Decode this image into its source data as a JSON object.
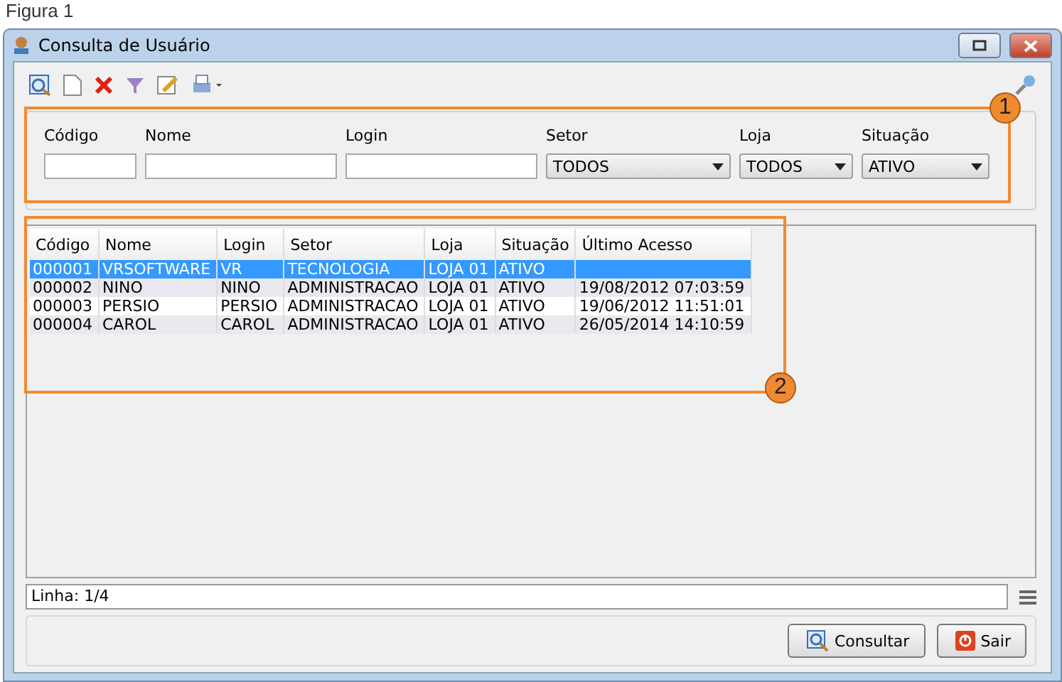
{
  "caption": "Figura 1",
  "window": {
    "title": "Consulta de Usuário"
  },
  "filters": [
    {
      "label": "Código",
      "kind": "text"
    },
    {
      "label": "Nome",
      "kind": "text"
    },
    {
      "label": "Login",
      "kind": "text"
    },
    {
      "label": "Setor",
      "kind": "select",
      "value": "TODOS"
    },
    {
      "label": "Loja",
      "kind": "select",
      "value": "TODOS"
    },
    {
      "label": "Situação",
      "kind": "select",
      "value": "ATIVO"
    }
  ],
  "table": {
    "columns": [
      "Código",
      "Nome",
      "Login",
      "Setor",
      "Loja",
      "Situação",
      "Último Acesso"
    ],
    "rows": [
      {
        "selected": true,
        "cells": [
          "000001",
          "VRSOFTWARE",
          "VR",
          "TECNOLOGIA",
          "LOJA 01",
          "ATIVO",
          ""
        ]
      },
      {
        "selected": false,
        "cells": [
          "000002",
          "NINO",
          "NINO",
          "ADMINISTRACAO",
          "LOJA 01",
          "ATIVO",
          "19/08/2012 07:03:59"
        ]
      },
      {
        "selected": false,
        "cells": [
          "000003",
          "PERSIO",
          "PERSIO",
          "ADMINISTRACAO",
          "LOJA 01",
          "ATIVO",
          "19/06/2012 11:51:01"
        ]
      },
      {
        "selected": false,
        "cells": [
          "000004",
          "CAROL",
          "CAROL",
          "ADMINISTRACAO",
          "LOJA 01",
          "ATIVO",
          "26/05/2014 14:10:59"
        ]
      }
    ]
  },
  "annotations": [
    "1",
    "2"
  ],
  "status_bar": "Linha: 1/4",
  "buttons": [
    {
      "label": "Consultar",
      "kind": "search"
    },
    {
      "label": "Sair",
      "kind": "exit"
    }
  ]
}
